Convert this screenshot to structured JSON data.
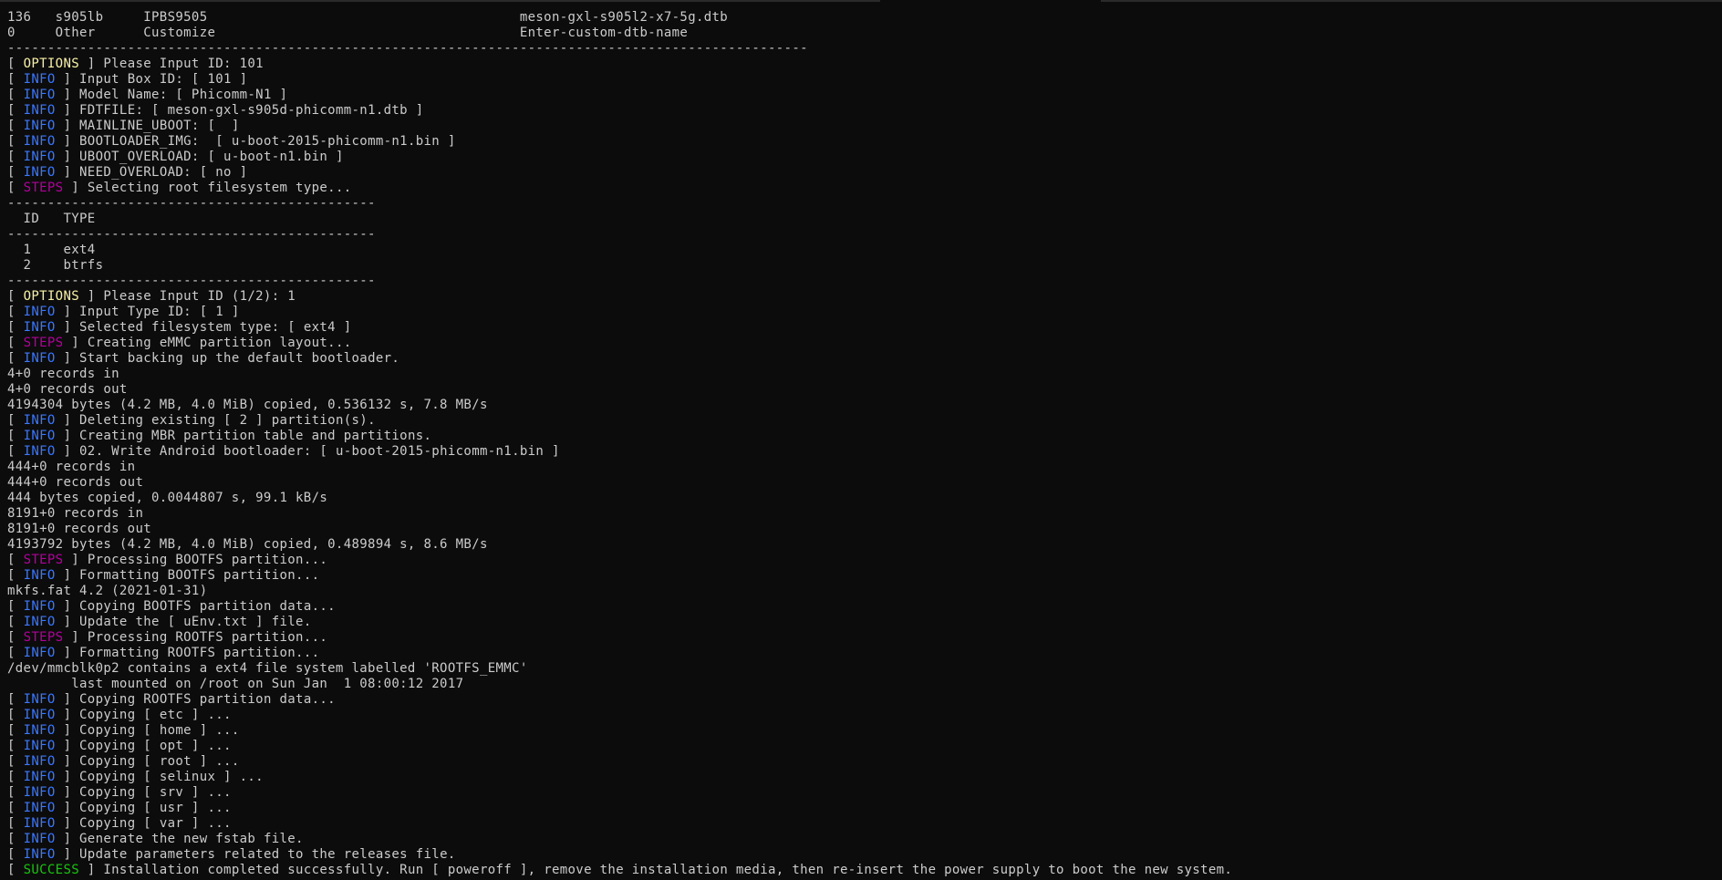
{
  "colors": {
    "options": "#f9f1a5",
    "info": "#3b78ff",
    "steps": "#b4009e",
    "success": "#16c60c",
    "text": "#cccccc",
    "background": "#0c0c0c"
  },
  "lines": [
    {
      "text": "136   s905lb     IPBS9505                                       meson-gxl-s905l2-x7-5g.dtb"
    },
    {
      "text": "0     Other      Customize                                      Enter-custom-dtb-name"
    },
    {
      "text": "----------------------------------------------------------------------------------------------------"
    },
    {
      "tag": "OPTIONS",
      "text": "Please Input ID: 101"
    },
    {
      "tag": "INFO",
      "text": "Input Box ID: [ 101 ]"
    },
    {
      "tag": "INFO",
      "text": "Model Name: [ Phicomm-N1 ]"
    },
    {
      "tag": "INFO",
      "text": "FDTFILE: [ meson-gxl-s905d-phicomm-n1.dtb ]"
    },
    {
      "tag": "INFO",
      "text": "MAINLINE_UBOOT: [  ]"
    },
    {
      "tag": "INFO",
      "text": "BOOTLOADER_IMG:  [ u-boot-2015-phicomm-n1.bin ]"
    },
    {
      "tag": "INFO",
      "text": "UBOOT_OVERLOAD: [ u-boot-n1.bin ]"
    },
    {
      "tag": "INFO",
      "text": "NEED_OVERLOAD: [ no ]"
    },
    {
      "tag": "STEPS",
      "text": "Selecting root filesystem type..."
    },
    {
      "text": "----------------------------------------------"
    },
    {
      "text": "  ID   TYPE"
    },
    {
      "text": "----------------------------------------------"
    },
    {
      "text": "  1    ext4"
    },
    {
      "text": "  2    btrfs"
    },
    {
      "text": "----------------------------------------------"
    },
    {
      "tag": "OPTIONS",
      "text": "Please Input ID (1/2): 1"
    },
    {
      "tag": "INFO",
      "text": "Input Type ID: [ 1 ]"
    },
    {
      "tag": "INFO",
      "text": "Selected filesystem type: [ ext4 ]"
    },
    {
      "tag": "STEPS",
      "text": "Creating eMMC partition layout..."
    },
    {
      "tag": "INFO",
      "text": "Start backing up the default bootloader."
    },
    {
      "text": "4+0 records in"
    },
    {
      "text": "4+0 records out"
    },
    {
      "text": "4194304 bytes (4.2 MB, 4.0 MiB) copied, 0.536132 s, 7.8 MB/s"
    },
    {
      "tag": "INFO",
      "text": "Deleting existing [ 2 ] partition(s)."
    },
    {
      "tag": "INFO",
      "text": "Creating MBR partition table and partitions."
    },
    {
      "tag": "INFO",
      "text": "02. Write Android bootloader: [ u-boot-2015-phicomm-n1.bin ]"
    },
    {
      "text": "444+0 records in"
    },
    {
      "text": "444+0 records out"
    },
    {
      "text": "444 bytes copied, 0.0044807 s, 99.1 kB/s"
    },
    {
      "text": "8191+0 records in"
    },
    {
      "text": "8191+0 records out"
    },
    {
      "text": "4193792 bytes (4.2 MB, 4.0 MiB) copied, 0.489894 s, 8.6 MB/s"
    },
    {
      "tag": "STEPS",
      "text": "Processing BOOTFS partition..."
    },
    {
      "tag": "INFO",
      "text": "Formatting BOOTFS partition..."
    },
    {
      "text": "mkfs.fat 4.2 (2021-01-31)"
    },
    {
      "tag": "INFO",
      "text": "Copying BOOTFS partition data..."
    },
    {
      "tag": "INFO",
      "text": "Update the [ uEnv.txt ] file."
    },
    {
      "tag": "STEPS",
      "text": "Processing ROOTFS partition..."
    },
    {
      "tag": "INFO",
      "text": "Formatting ROOTFS partition..."
    },
    {
      "text": "/dev/mmcblk0p2 contains a ext4 file system labelled 'ROOTFS_EMMC'"
    },
    {
      "text": "        last mounted on /root on Sun Jan  1 08:00:12 2017"
    },
    {
      "tag": "INFO",
      "text": "Copying ROOTFS partition data..."
    },
    {
      "tag": "INFO",
      "text": "Copying [ etc ] ..."
    },
    {
      "tag": "INFO",
      "text": "Copying [ home ] ..."
    },
    {
      "tag": "INFO",
      "text": "Copying [ opt ] ..."
    },
    {
      "tag": "INFO",
      "text": "Copying [ root ] ..."
    },
    {
      "tag": "INFO",
      "text": "Copying [ selinux ] ..."
    },
    {
      "tag": "INFO",
      "text": "Copying [ srv ] ..."
    },
    {
      "tag": "INFO",
      "text": "Copying [ usr ] ..."
    },
    {
      "tag": "INFO",
      "text": "Copying [ var ] ..."
    },
    {
      "tag": "INFO",
      "text": "Generate the new fstab file."
    },
    {
      "tag": "INFO",
      "text": "Update parameters related to the releases file."
    },
    {
      "tag": "SUCCESS",
      "text": "Installation completed successfully. Run [ poweroff ], remove the installation media, then re-insert the power supply to boot the new system."
    }
  ]
}
